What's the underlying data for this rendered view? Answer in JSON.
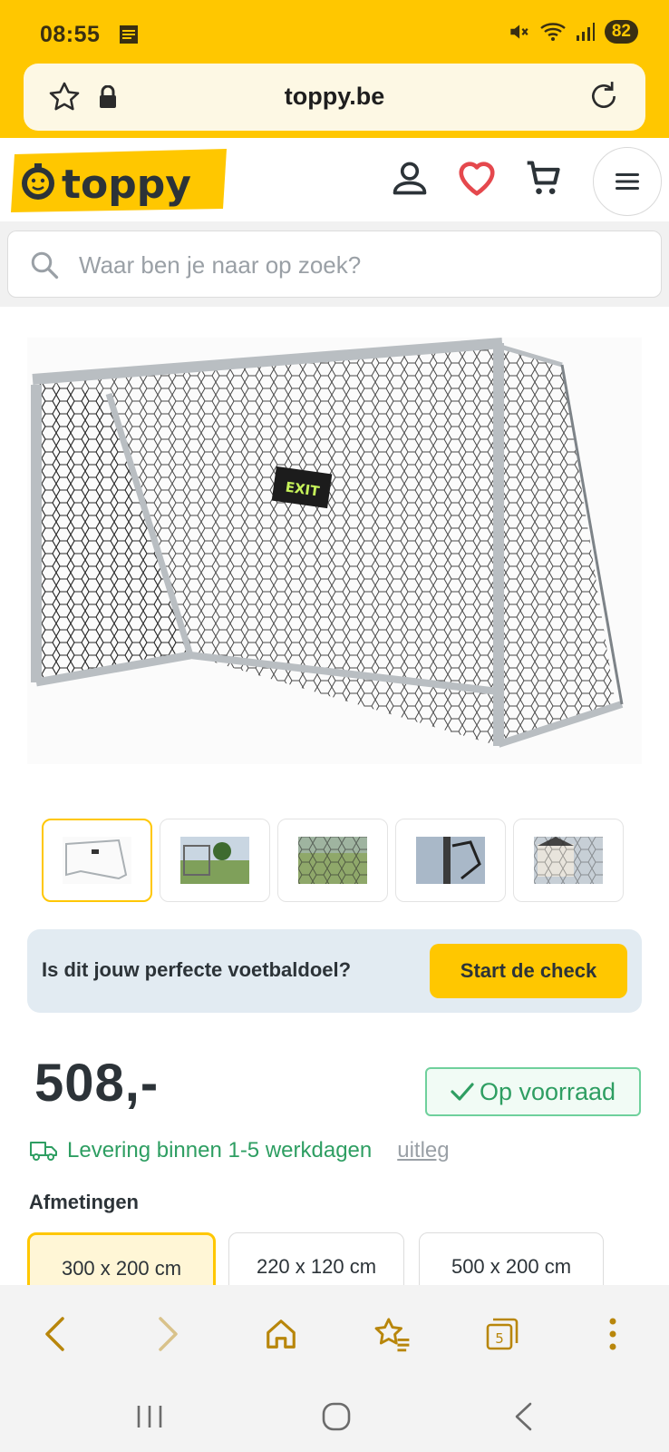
{
  "status_bar": {
    "time": "08:55",
    "battery": "82"
  },
  "browser": {
    "url": "toppy.be"
  },
  "site": {
    "logo_text": "toppy",
    "search_placeholder": "Waar ben je naar op zoek?"
  },
  "product": {
    "image_logo_text": "EXIT",
    "thumbnail_count": 5,
    "check_banner": {
      "text": "Is dit jouw perfecte voetbaldoel?",
      "button": "Start de check"
    },
    "price": "508,-",
    "stock": "Op voorraad",
    "delivery_text": "Levering binnen 1-5 werkdagen",
    "delivery_link": "uitleg",
    "dimensions_title": "Afmetingen",
    "sizes": [
      {
        "label": "300 x 200 cm",
        "selected": true
      },
      {
        "label": "220 x 120 cm",
        "selected": false
      },
      {
        "label": "500 x 200 cm",
        "selected": false
      }
    ]
  },
  "toolbar": {
    "tabs_count": "5"
  },
  "colors": {
    "brand_yellow": "#ffc700",
    "success_green": "#2e9e62",
    "heart_red": "#e5484d",
    "banner_blue": "#e2ebf2"
  }
}
